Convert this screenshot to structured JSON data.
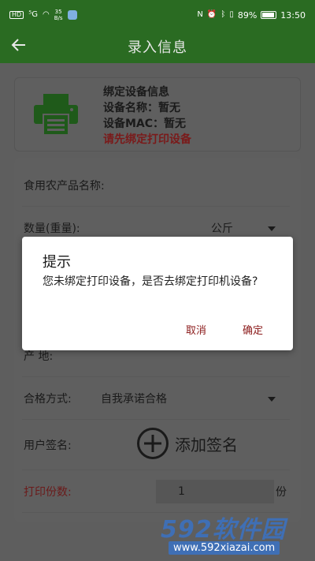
{
  "status_bar": {
    "hd_label": "HD",
    "signal_label": "⁵G",
    "net_speed_value": "35",
    "net_speed_unit": "B/s",
    "battery_percent": "89%",
    "time": "13:50"
  },
  "app_bar": {
    "title": "录入信息",
    "back_icon": "arrow-left-icon"
  },
  "device_card": {
    "icon": "printer-icon",
    "heading": "绑定设备信息",
    "name_line": "设备名称：暂无",
    "mac_line": "设备MAC：暂无",
    "warning": "请先绑定打印设备"
  },
  "form": {
    "product_name_label": "食用农产品名称:",
    "quantity_label": "数量(重量):",
    "quantity_unit": "公斤",
    "origin_label": "产      地:",
    "qualification_label": "合格方式:",
    "qualification_value": "自我承诺合格",
    "signature_label": "用户签名:",
    "signature_button": "添加签名",
    "copies_label": "打印份数:",
    "copies_value": "1",
    "copies_unit": "份"
  },
  "dialog": {
    "title": "提示",
    "message": "您未绑定打印设备，是否去绑定打印机设备?",
    "cancel_label": "取消",
    "confirm_label": "确定"
  },
  "watermark": {
    "brand": "592软件园",
    "url": "www.592xiazai.com"
  },
  "colors": {
    "primary": "#2a6b22",
    "warning_text": "#8b1a1a",
    "dialog_bg": "#ffffff"
  }
}
